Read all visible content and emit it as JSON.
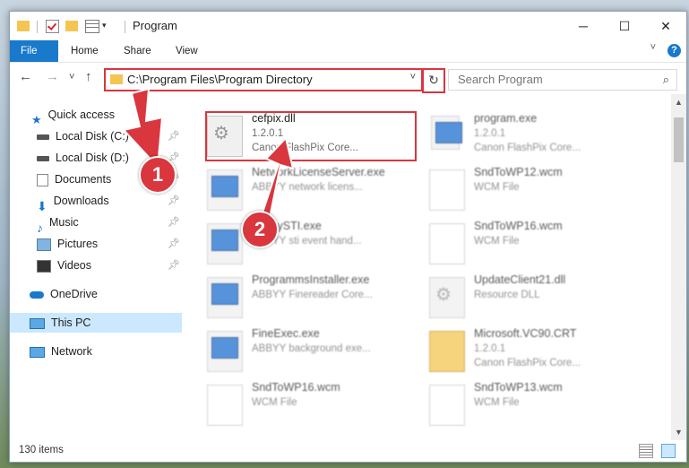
{
  "window": {
    "title": "Program",
    "minimize_glyph": "─",
    "maximize_glyph": "☐",
    "close_glyph": "✕"
  },
  "ribbon": {
    "tabs": [
      "File",
      "Home",
      "Share",
      "View"
    ],
    "help_glyph": "?"
  },
  "nav": {
    "back_glyph": "←",
    "forward_glyph": "→",
    "recent_glyph": "˅",
    "up_glyph": "↑",
    "address": "C:\\Program Files\\Program Directory",
    "refresh_glyph": "↻",
    "search_placeholder": "Search Program"
  },
  "sidebar": {
    "items": [
      {
        "label": "Quick access",
        "icon": "star-icon",
        "pinned": false
      },
      {
        "label": "Local Disk (C:)",
        "icon": "drive-icon",
        "pinned": true
      },
      {
        "label": "Local Disk (D:)",
        "icon": "drive-icon",
        "pinned": true
      },
      {
        "label": "Documents",
        "icon": "documents-icon",
        "pinned": true
      },
      {
        "label": "Downloads",
        "icon": "downloads-icon",
        "pinned": true
      },
      {
        "label": "Music",
        "icon": "music-icon",
        "pinned": true
      },
      {
        "label": "Pictures",
        "icon": "pictures-icon",
        "pinned": true
      },
      {
        "label": "Videos",
        "icon": "videos-icon",
        "pinned": true
      },
      {
        "label": "OneDrive",
        "icon": "cloud-icon",
        "pinned": false
      },
      {
        "label": "This PC",
        "icon": "computer-icon",
        "pinned": false,
        "selected": true
      },
      {
        "label": "Network",
        "icon": "network-icon",
        "pinned": false
      }
    ]
  },
  "files": [
    {
      "name": "cefpix.dll",
      "line1": "1.2.0.1",
      "line2": "Canon FlashPix Core...",
      "icon": "dll-icon"
    },
    {
      "name": "program.exe",
      "line1": "1.2.0.1",
      "line2": "Canon FlashPix Core...",
      "icon": "exe-icon"
    },
    {
      "name": "NetworkLicenseServer.exe",
      "line1": "ABBYY network licens...",
      "line2": "",
      "icon": "exe-icon"
    },
    {
      "name": "SndToWP12.wcm",
      "line1": "WCM File",
      "line2": "",
      "icon": "document-icon"
    },
    {
      "name": "AbbyySTI.exe",
      "line1": "ABBYY sti event hand...",
      "line2": "",
      "icon": "exe-icon"
    },
    {
      "name": "SndToWP16.wcm",
      "line1": "WCM File",
      "line2": "",
      "icon": "document-icon"
    },
    {
      "name": "ProgrammsInstaller.exe",
      "line1": "ABBYY Finereader Core...",
      "line2": "",
      "icon": "exe-icon"
    },
    {
      "name": "UpdateClient21.dll",
      "line1": "Resource DLL",
      "line2": "",
      "icon": "dll-icon"
    },
    {
      "name": "FineExec.exe",
      "line1": "ABBYY background exe...",
      "line2": "",
      "icon": "exe-icon"
    },
    {
      "name": "Microsoft.VC90.CRT",
      "line1": "1.2.0.1",
      "line2": "Canon FlashPix Core...",
      "icon": "folder-doc-icon"
    },
    {
      "name": "SndToWP16.wcm",
      "line1": "WCM File",
      "line2": "",
      "icon": "document-icon"
    },
    {
      "name": "SndToWP13.wcm",
      "line1": "WCM File",
      "line2": "",
      "icon": "document-icon"
    }
  ],
  "status": {
    "item_count": "130 items"
  },
  "annotations": {
    "step1": "1",
    "step2": "2",
    "accent": "#d9363e"
  }
}
